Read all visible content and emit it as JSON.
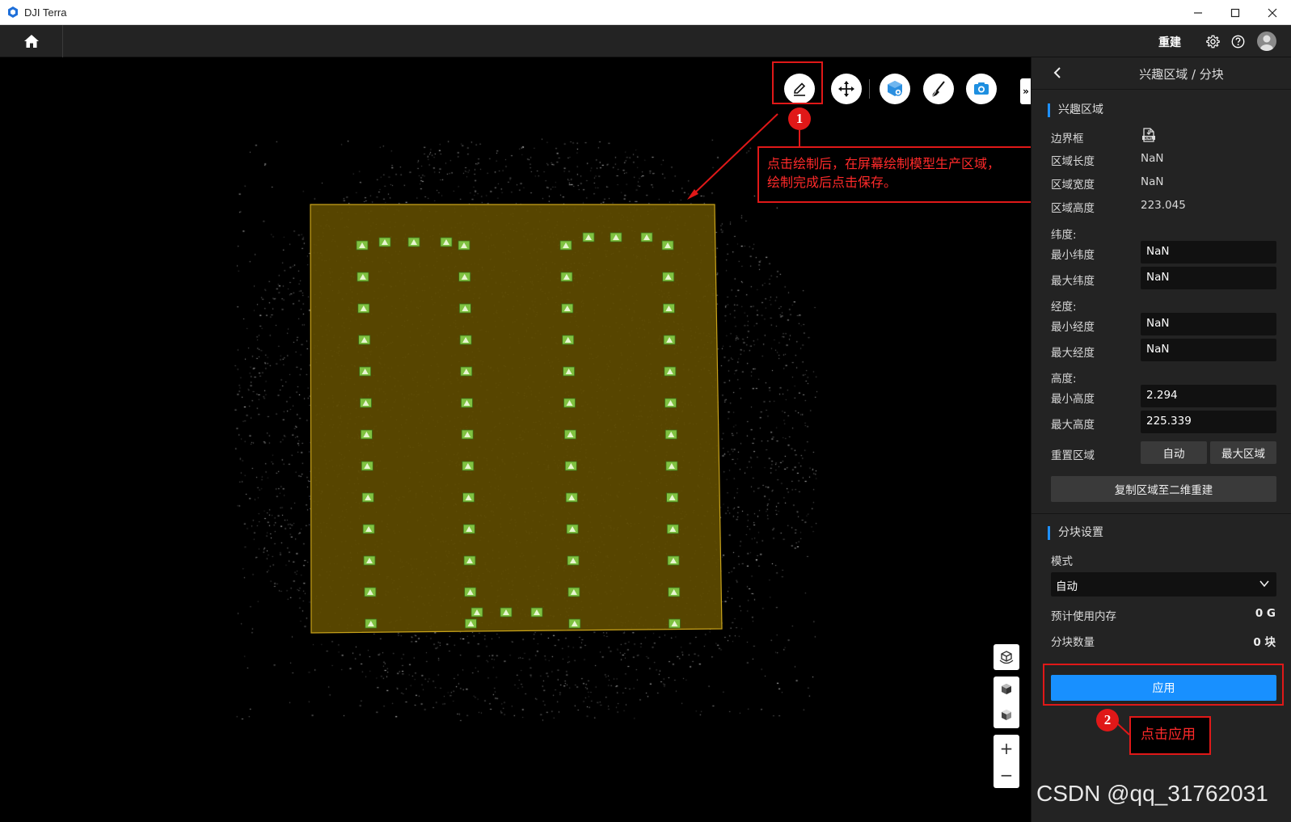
{
  "window": {
    "title": "DJI Terra",
    "minimize": "—",
    "maximize": "☐",
    "close": "✕"
  },
  "topbar": {
    "reconstruct_label": "重建",
    "icons": [
      "home-icon",
      "gear-icon",
      "help-icon",
      "user-avatar-icon"
    ]
  },
  "toolbar": {
    "tools": [
      "draw-icon",
      "move-icon",
      "view-3d-icon",
      "brush-icon",
      "camera-icon"
    ],
    "collapse": "»"
  },
  "annotations": {
    "step1": {
      "number": "1",
      "text_line1": "点击绘制后，在屏幕绘制模型生产区域，",
      "text_line2": "绘制完成后点击保存。"
    },
    "step2": {
      "number": "2",
      "text": "点击应用"
    }
  },
  "view_tools": {
    "zoom_in": "+",
    "zoom_out": "−"
  },
  "panel": {
    "title": "兴趣区域 / 分块",
    "roi": {
      "section": "兴趣区域",
      "bbox_label": "边界框",
      "bbox_icon": "kml-file-icon",
      "length_label": "区域长度",
      "length_value": "NaN",
      "width_label": "区域宽度",
      "width_value": "NaN",
      "height_label": "区域高度",
      "height_value": "223.045",
      "lat_header": "纬度:",
      "min_lat_label": "最小纬度",
      "min_lat_value": "NaN",
      "max_lat_label": "最大纬度",
      "max_lat_value": "NaN",
      "lon_header": "经度:",
      "min_lon_label": "最小经度",
      "min_lon_value": "NaN",
      "max_lon_label": "最大经度",
      "max_lon_value": "NaN",
      "alt_header": "高度:",
      "min_alt_label": "最小高度",
      "min_alt_value": "2.294",
      "max_alt_label": "最大高度",
      "max_alt_value": "225.339",
      "reset_label": "重置区域",
      "auto_button": "自动",
      "max_area_button": "最大区域",
      "copy_button": "复制区域至二维重建"
    },
    "tiling": {
      "section": "分块设置",
      "mode_label": "模式",
      "mode_value": "自动",
      "memory_label": "预计使用内存",
      "memory_value": "0 G",
      "count_label": "分块数量",
      "count_value": "0 块",
      "apply_button": "应用"
    }
  },
  "watermark": "CSDN @qq_31762031",
  "colors": {
    "accent": "#1890ff",
    "annotation_red": "#e01818",
    "roi_fill": "#5e4a00",
    "roi_border": "#c8a21a",
    "camera_marker": "#7fc241",
    "panel_bg": "#232323"
  }
}
